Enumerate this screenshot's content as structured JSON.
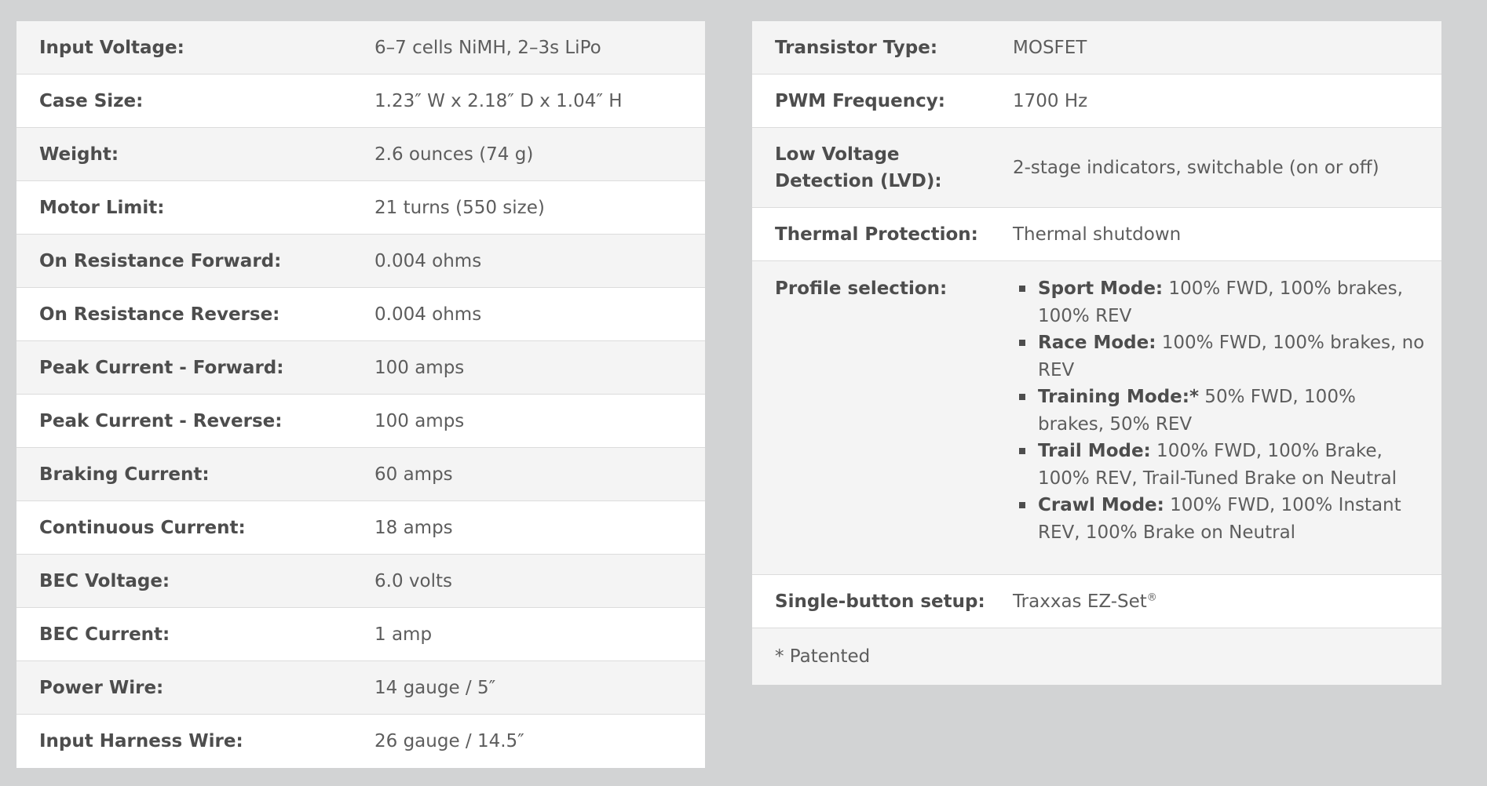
{
  "left_specs": [
    {
      "label": "Input Voltage:",
      "value": "6–7 cells NiMH, 2–3s LiPo"
    },
    {
      "label": "Case Size:",
      "value": "1.23″ W x 2.18″ D x 1.04″ H"
    },
    {
      "label": "Weight:",
      "value": "2.6 ounces (74 g)"
    },
    {
      "label": "Motor Limit:",
      "value": "21 turns (550 size)"
    },
    {
      "label": "On Resistance Forward:",
      "value": "0.004 ohms"
    },
    {
      "label": "On Resistance Reverse:",
      "value": "0.004 ohms"
    },
    {
      "label": "Peak Current - Forward:",
      "value": "100 amps"
    },
    {
      "label": "Peak Current - Reverse:",
      "value": "100 amps"
    },
    {
      "label": "Braking Current:",
      "value": "60 amps"
    },
    {
      "label": "Continuous Current:",
      "value": "18 amps"
    },
    {
      "label": "BEC Voltage:",
      "value": "6.0 volts"
    },
    {
      "label": "BEC Current:",
      "value": "1 amp"
    },
    {
      "label": "Power Wire:",
      "value": "14 gauge / 5″"
    },
    {
      "label": "Input Harness Wire:",
      "value": "26 gauge / 14.5″"
    }
  ],
  "right_specs": {
    "transistor": {
      "label": "Transistor Type:",
      "value": "MOSFET"
    },
    "pwm": {
      "label": "PWM Frequency:",
      "value": "1700 Hz"
    },
    "lvd": {
      "label_line1": "Low Voltage",
      "label_line2": "Detection (LVD):",
      "value": "2-stage indicators, switchable (on or off)"
    },
    "thermal": {
      "label": "Thermal Protection:",
      "value": "Thermal shutdown"
    },
    "profile": {
      "label": "Profile selection:",
      "modes": [
        {
          "name": "Sport Mode:",
          "desc": " 100% FWD, 100% brakes, 100% REV"
        },
        {
          "name": "Race Mode:",
          "desc": " 100% FWD, 100% brakes, no REV"
        },
        {
          "name": "Training Mode:*",
          "desc": " 50% FWD, 100% brakes, 50% REV"
        },
        {
          "name": "Trail Mode:",
          "desc": " 100% FWD, 100% Brake, 100% REV, Trail-Tuned Brake on Neutral"
        },
        {
          "name": "Crawl Mode:",
          "desc": " 100% FWD, 100% Instant REV, 100% Brake on Neutral"
        }
      ]
    },
    "setup": {
      "label": "Single-button setup:",
      "value": "Traxxas EZ-Set",
      "mark": "®"
    },
    "note": "* Patented"
  }
}
